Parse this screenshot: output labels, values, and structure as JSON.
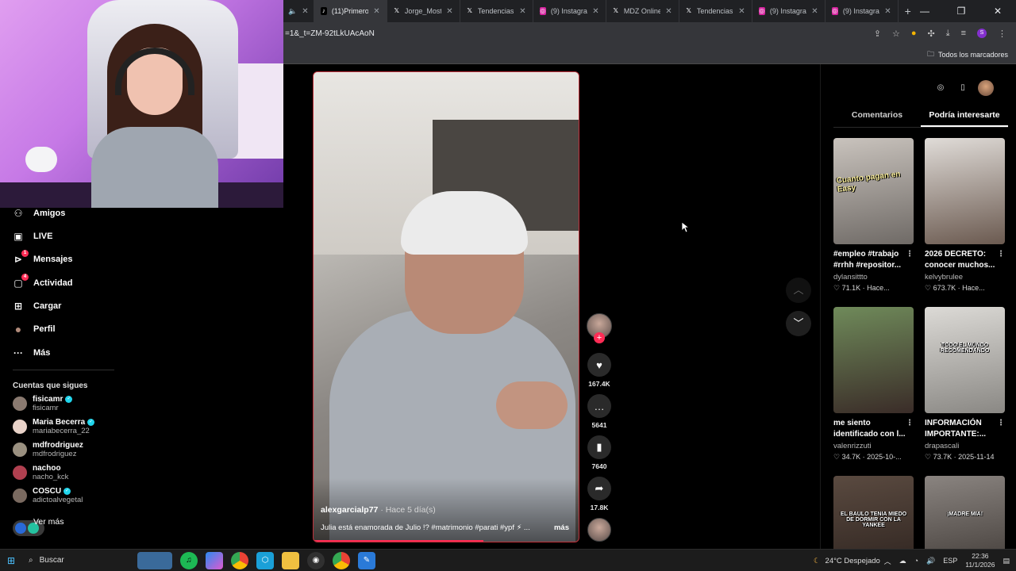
{
  "browser": {
    "tabs": [
      {
        "label": "(11)Primeros",
        "icon": "tiktok-icon",
        "active": true
      },
      {
        "label": "Jorge_Most",
        "icon": "x-icon"
      },
      {
        "label": "Tendencias",
        "icon": "x-icon"
      },
      {
        "label": "(9) Instagram",
        "icon": "instagram-icon"
      },
      {
        "label": "MDZ Online",
        "icon": "x-icon"
      },
      {
        "label": "Tendencias",
        "icon": "x-icon"
      },
      {
        "label": "(9) Instagram",
        "icon": "instagram-icon"
      },
      {
        "label": "(9) Instagram",
        "icon": "instagram-icon"
      }
    ],
    "url": "=1&_t=ZM-92tLkUAcAoN",
    "bookmarks_all": "Todos los marcadores",
    "profile_initial": "S"
  },
  "sidebar": {
    "items": [
      {
        "label": "Amigos",
        "icon": "friends-icon",
        "badge": ""
      },
      {
        "label": "LIVE",
        "icon": "live-icon",
        "badge": ""
      },
      {
        "label": "Mensajes",
        "icon": "messages-icon",
        "badge": "1"
      },
      {
        "label": "Actividad",
        "icon": "activity-icon",
        "badge": "4"
      },
      {
        "label": "Cargar",
        "icon": "upload-icon",
        "badge": ""
      },
      {
        "label": "Perfil",
        "icon": "profile-icon",
        "badge": ""
      },
      {
        "label": "Más",
        "icon": "more-icon",
        "badge": ""
      }
    ],
    "following_title": "Cuentas que sigues",
    "accounts": [
      {
        "name": "fisicamr",
        "handle": "fisicamr",
        "verified": true,
        "color": "#8a7a70"
      },
      {
        "name": "Maria Becerra",
        "handle": "mariabecerra_22",
        "verified": true,
        "color": "#e8d2c8"
      },
      {
        "name": "mdfrodriguez",
        "handle": "mdfrodriguez",
        "verified": false,
        "color": "#9a9080"
      },
      {
        "name": "nachoo",
        "handle": "nacho_kck",
        "verified": false,
        "color": "#b04050"
      },
      {
        "name": "COSCU",
        "handle": "adictoalvegetal",
        "verified": true,
        "color": "#7a6a60"
      }
    ],
    "see_more": "Ver más"
  },
  "video": {
    "author": "alexgarcialp77",
    "time_ago": "· Hace 5 día(s)",
    "caption": "Julia está enamorada de Julio !? #matrimonio #parati #ypf ⚡ ...",
    "more": "más",
    "progress": 0.64
  },
  "actions": {
    "likes": "167.4K",
    "comments": "5641",
    "saves": "7640",
    "shares": "17.8K"
  },
  "right_panel": {
    "tabs": [
      "Comentarios",
      "Podría interesarte"
    ],
    "active_tab": 1,
    "cards": [
      {
        "title": "#empleo #trabajo #rrhh #repositor...",
        "user": "dylansittto",
        "meta": "♡ 71.1K · Hace...",
        "thumb_text": "Cuanto pagan en Easy",
        "thumb_colors": [
          "#c9c3bd",
          "#6f6a66"
        ]
      },
      {
        "title": "2026 DECRETO: conocer muchos...",
        "user": "kelvybrulee",
        "meta": "♡ 673.7K · Hace...",
        "thumb_text": "",
        "thumb_colors": [
          "#e0dcd8",
          "#6b5a50"
        ]
      },
      {
        "title": "me siento identificado con l...",
        "user": "valenrizzuti",
        "meta": "♡ 34.7K · 2025-10-...",
        "thumb_text": "",
        "thumb_colors": [
          "#6f8a5a",
          "#3a2c28"
        ]
      },
      {
        "title": "INFORMACIÓN IMPORTANTE:...",
        "user": "drapascali",
        "meta": "♡ 73.7K · 2025-11-14",
        "thumb_text": "TODO EL MUNDO RECOMENDANDO",
        "thumb_colors": [
          "#dcdad6",
          "#8a8884"
        ]
      },
      {
        "title": "",
        "user": "",
        "meta": "",
        "thumb_text": "EL BAULO TENIA MIEDO DE DORMIR CON LA YANKEE",
        "thumb_colors": [
          "#5a4a40",
          "#2a201c"
        ]
      },
      {
        "title": "",
        "user": "",
        "meta": "",
        "thumb_text": "¡MADRE MIA!",
        "thumb_colors": [
          "#8a8480",
          "#3a3430"
        ]
      }
    ]
  },
  "taskbar": {
    "search": "Buscar",
    "weather": "24°C  Despejado",
    "lang": "ESP",
    "time": "22:36",
    "date": "11/1/2026"
  }
}
